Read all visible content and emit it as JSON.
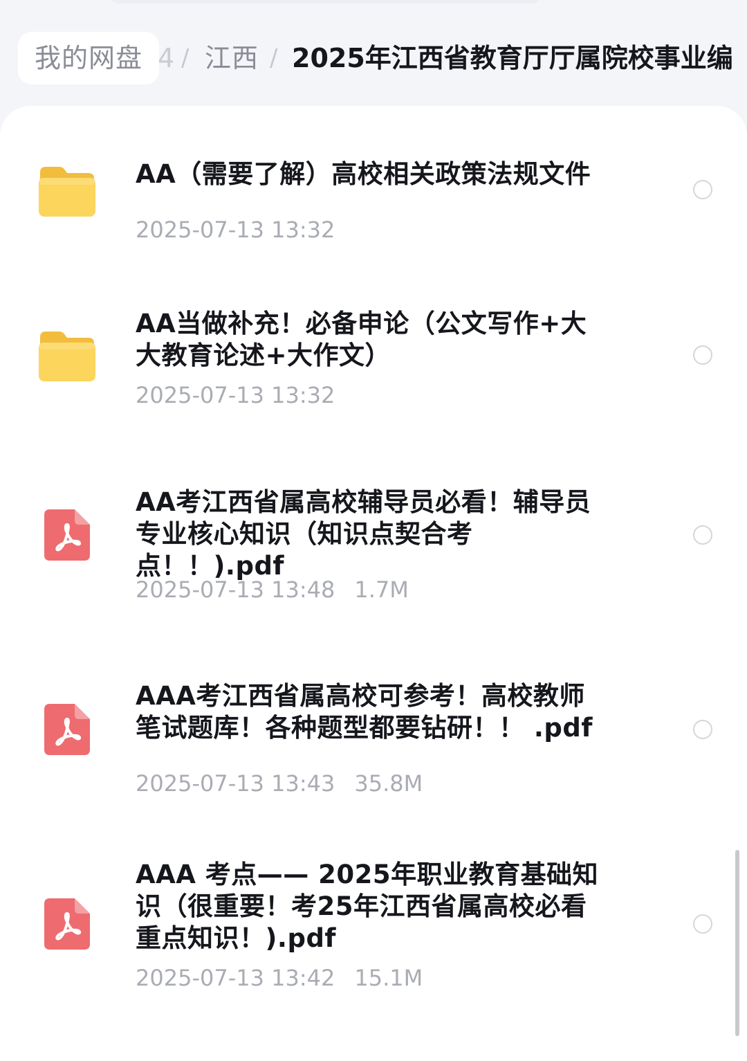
{
  "breadcrumb": {
    "root": "我的网盘",
    "hidden_fragment": "4",
    "separator": "/",
    "middle": "江西",
    "current": "2025年江西省教育厅厅属院校事业编"
  },
  "files": [
    {
      "type": "folder",
      "icon": "folder-icon",
      "name": "AA（需要了解）高校相关政策法规文件",
      "date": "2025-07-13 13:32",
      "size": ""
    },
    {
      "type": "folder",
      "icon": "folder-icon",
      "name": "AA当做补充！必备申论（公文写作+大\n大教育论述+大作文）",
      "date": "2025-07-13 13:32",
      "size": ""
    },
    {
      "type": "pdf",
      "icon": "pdf-icon",
      "name": "AA考江西省属高校辅导员必看！辅导员\n专业核心知识（知识点契合考点！！).pdf",
      "date": "2025-07-13 13:48",
      "size": "1.7M"
    },
    {
      "type": "pdf",
      "icon": "pdf-icon",
      "name": "AAA考江西省属高校可参考！高校教师\n笔试题库！各种题型都要钻研！！ .pdf",
      "date": "2025-07-13 13:43",
      "size": "35.8M"
    },
    {
      "type": "pdf",
      "icon": "pdf-icon",
      "name": "AAA 考点—— 2025年职业教育基础知\n识（很重要！考25年江西省属高校必看\n重点知识！).pdf",
      "date": "2025-07-13 13:42",
      "size": "15.1M"
    }
  ],
  "colors": {
    "folder": "#f7cd4f",
    "pdf": "#ee6b6f",
    "text_primary": "#15171c",
    "text_secondary": "#a9acb3"
  }
}
